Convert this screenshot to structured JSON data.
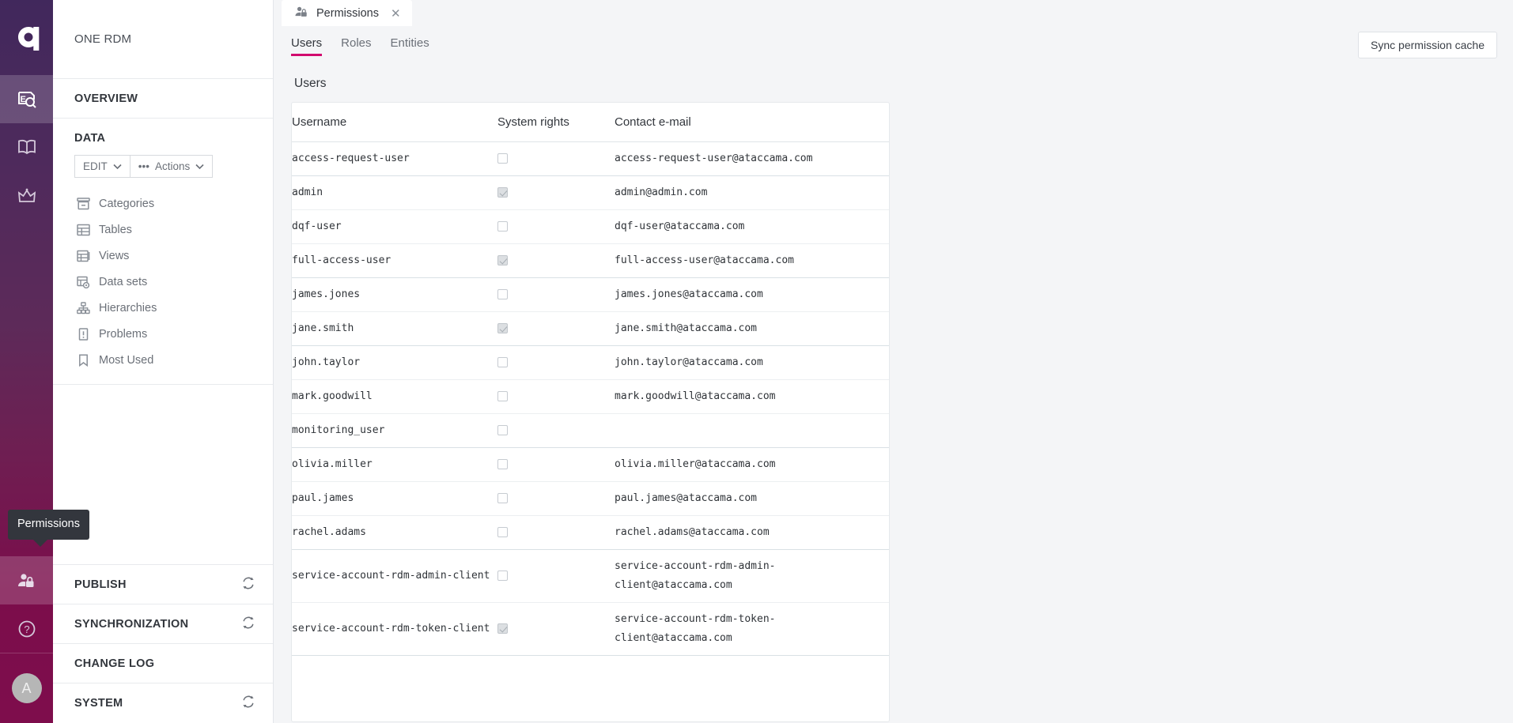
{
  "rail": {
    "logo_name": "ataccama-logo",
    "items": [
      {
        "name": "explore-icon",
        "label": "Explore",
        "active": true
      },
      {
        "name": "catalog-book-icon",
        "label": "Catalog",
        "active": false
      },
      {
        "name": "crown-icon",
        "label": "Governance",
        "active": false
      },
      {
        "name": "permissions-user-lock-icon",
        "label": "Permissions",
        "active": true
      },
      {
        "name": "help-question-icon",
        "label": "Help",
        "active": false
      }
    ],
    "avatar_initial": "A",
    "tooltip": "Permissions"
  },
  "panel": {
    "brand": "ONE RDM",
    "overview_label": "OVERVIEW",
    "data_label": "DATA",
    "buttons": [
      {
        "name": "edit-button",
        "label": "EDIT",
        "caret": "⌄",
        "dots": ""
      },
      {
        "name": "actions-button",
        "label": "Actions",
        "caret": "⌄",
        "dots": "•••"
      }
    ],
    "nav": [
      {
        "label": "Categories",
        "icon": "categories-icon"
      },
      {
        "label": "Tables",
        "icon": "tables-icon"
      },
      {
        "label": "Views",
        "icon": "views-icon"
      },
      {
        "label": "Data sets",
        "icon": "data-sets-icon"
      },
      {
        "label": "Hierarchies",
        "icon": "hierarchies-icon"
      },
      {
        "label": "Problems",
        "icon": "problems-icon"
      },
      {
        "label": "Most Used",
        "icon": "bookmark-icon"
      }
    ],
    "sections": [
      {
        "label": "PUBLISH",
        "sync": true
      },
      {
        "label": "SYNCHRONIZATION",
        "sync": true
      },
      {
        "label": "CHANGE LOG",
        "sync": false
      },
      {
        "label": "SYSTEM",
        "sync": true
      }
    ]
  },
  "main": {
    "tab": {
      "title": "Permissions",
      "icon": "permissions-user-lock-icon",
      "close": "✕"
    },
    "subtabs": [
      {
        "label": "Users",
        "active": true
      },
      {
        "label": "Roles",
        "active": false
      },
      {
        "label": "Entities",
        "active": false
      }
    ],
    "sync_cache_button": "Sync permission cache",
    "section_title": "Users",
    "table": {
      "columns": [
        "Username",
        "System rights",
        "Contact e-mail"
      ],
      "rows": [
        {
          "username": "access-request-user",
          "rights": false,
          "email": "access-request-user@ataccama.com"
        },
        {
          "username": "admin",
          "rights": true,
          "email": "admin@admin.com"
        },
        {
          "username": "dqf-user",
          "rights": false,
          "email": "dqf-user@ataccama.com"
        },
        {
          "username": "full-access-user",
          "rights": true,
          "email": "full-access-user@ataccama.com"
        },
        {
          "username": "james.jones",
          "rights": false,
          "email": "james.jones@ataccama.com"
        },
        {
          "username": "jane.smith",
          "rights": true,
          "email": "jane.smith@ataccama.com"
        },
        {
          "username": "john.taylor",
          "rights": false,
          "email": "john.taylor@ataccama.com"
        },
        {
          "username": "mark.goodwill",
          "rights": false,
          "email": "mark.goodwill@ataccama.com"
        },
        {
          "username": "monitoring_user",
          "rights": false,
          "email": ""
        },
        {
          "username": "olivia.miller",
          "rights": false,
          "email": "olivia.miller@ataccama.com"
        },
        {
          "username": "paul.james",
          "rights": false,
          "email": "paul.james@ataccama.com"
        },
        {
          "username": "rachel.adams",
          "rights": false,
          "email": "rachel.adams@ataccama.com"
        },
        {
          "username": "service-account-rdm-admin-client",
          "rights": false,
          "email": "service-account-rdm-admin-client@ataccama.com"
        },
        {
          "username": "service-account-rdm-token-client",
          "rights": true,
          "email": "service-account-rdm-token-client@ataccama.com"
        }
      ]
    }
  },
  "colors": {
    "accent": "#d10a6e",
    "rail_top": "#41285c",
    "rail_bottom": "#7e0d4c",
    "tooltip_bg": "#33363d"
  }
}
